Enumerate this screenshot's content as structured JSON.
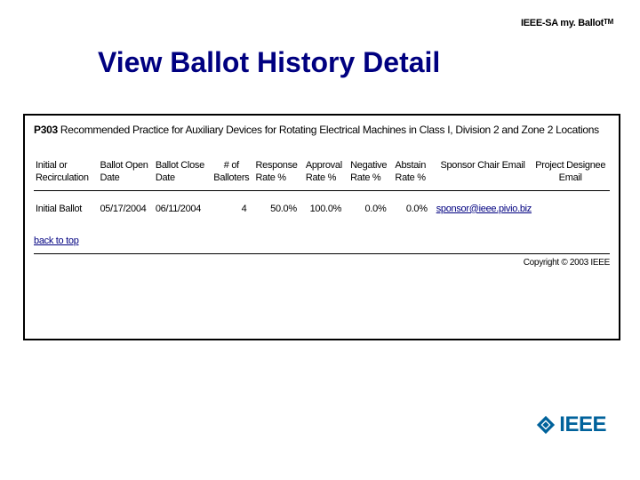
{
  "brand": {
    "prefix": "IEEE-SA ",
    "name": "my. Ballot",
    "tm": "TM"
  },
  "title": "View Ballot History Detail",
  "project": {
    "id": "P303",
    "description": "Recommended Practice for Auxiliary Devices for Rotating Electrical Machines in Class I, Division 2 and Zone 2 Locations"
  },
  "table": {
    "headers": [
      "Initial or Recirculation",
      "Ballot Open Date",
      "Ballot Close Date",
      "# of Balloters",
      "Response Rate %",
      "Approval Rate %",
      "Negative Rate %",
      "Abstain Rate %",
      "Sponsor Chair Email",
      "Project Designee Email"
    ],
    "rows": [
      {
        "type": "Initial Ballot",
        "open": "05/17/2004",
        "close": "06/11/2004",
        "balloters": "4",
        "response": "50.0%",
        "approval": "100.0%",
        "negative": "0.0%",
        "abstain": "0.0%",
        "sponsor_email": "sponsor@ieee.pivio.biz",
        "designee_email": ""
      }
    ]
  },
  "links": {
    "back_to_top": "back to top"
  },
  "copyright": "Copyright © 2003 IEEE",
  "logo": {
    "text": "IEEE"
  }
}
